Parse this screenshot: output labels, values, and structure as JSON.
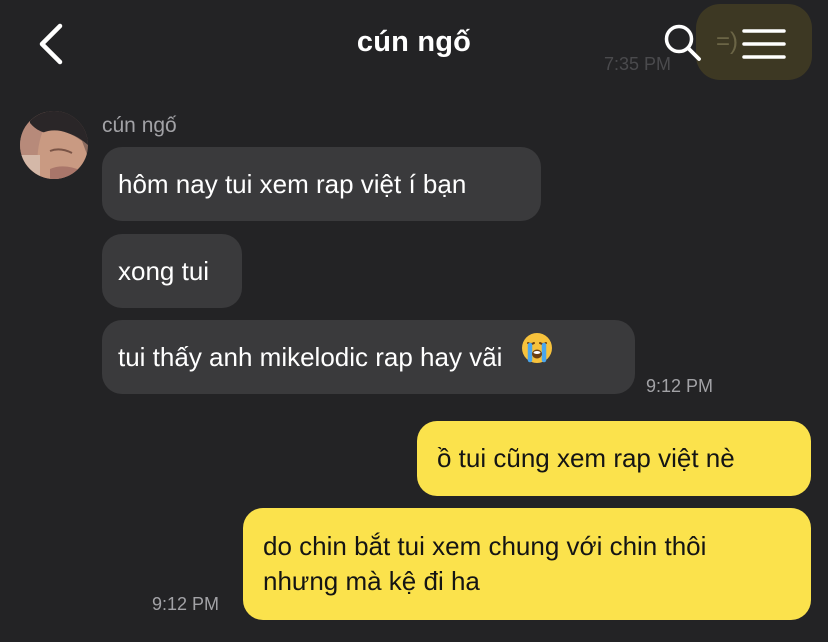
{
  "header": {
    "title": "cún ngố",
    "back_icon": "chevron-left-icon",
    "search_icon": "search-icon",
    "menu_icon": "hamburger-menu-icon",
    "peek_text": "=)",
    "peek_time": "7:35 PM"
  },
  "incoming": {
    "sender": "cún ngố",
    "messages": [
      {
        "text": "hôm nay tui xem rap việt í bạn"
      },
      {
        "text": "xong tui"
      },
      {
        "text": "tui thấy anh mikelodic rap hay vãi",
        "emoji": "loudly-crying-face-icon"
      }
    ],
    "time": "9:12 PM"
  },
  "outgoing": {
    "messages": [
      {
        "lines": [
          "ồ tui cũng xem rap việt nè"
        ]
      },
      {
        "lines": [
          "do chin bắt tui xem chung với chin thôi",
          "nhưng mà kệ đi ha"
        ]
      }
    ],
    "time": "9:12 PM"
  },
  "colors": {
    "background": "#232325",
    "incoming_bubble": "#3a3a3c",
    "outgoing_bubble": "#fbe24c",
    "timestamp": "#a2a2a6"
  }
}
